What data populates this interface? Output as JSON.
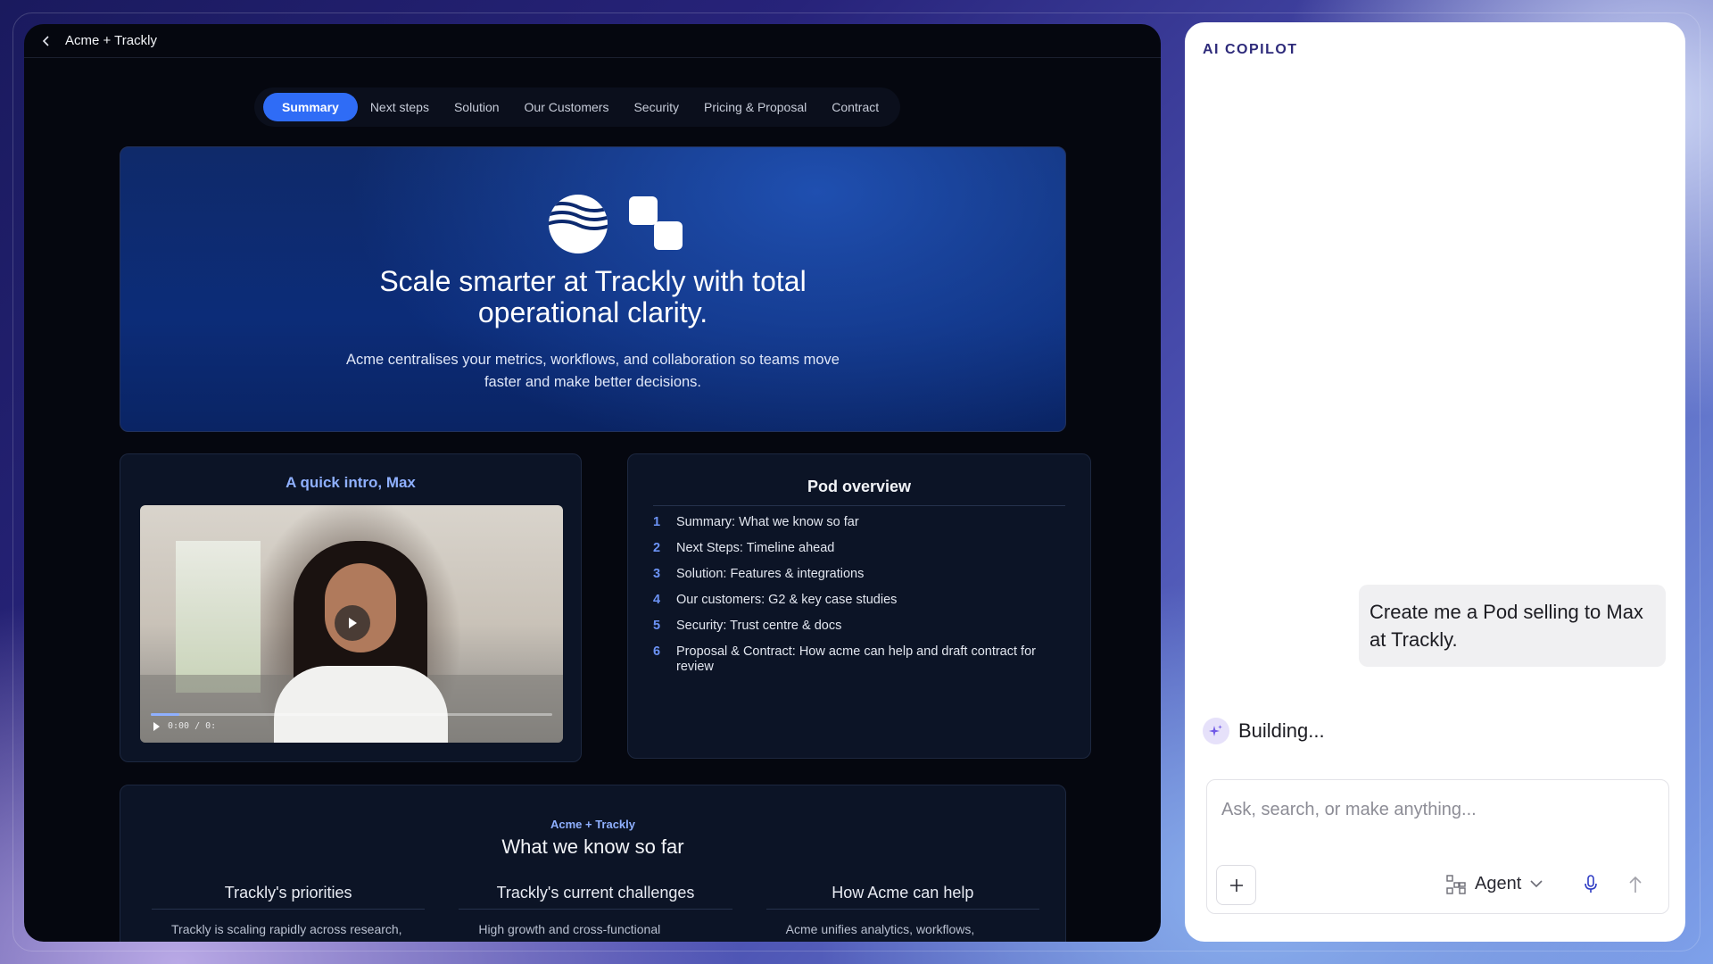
{
  "app": {
    "title": "Acme + Trackly",
    "tabs": [
      {
        "label": "Summary",
        "active": true
      },
      {
        "label": "Next steps"
      },
      {
        "label": "Solution"
      },
      {
        "label": "Our Customers"
      },
      {
        "label": "Security"
      },
      {
        "label": "Pricing & Proposal"
      },
      {
        "label": "Contract"
      }
    ]
  },
  "hero": {
    "title_line1": "Scale smarter at Trackly with total",
    "title_line2": "operational clarity.",
    "subtitle_line1": "Acme centralises your metrics, workflows, and collaboration so teams move",
    "subtitle_line2": "faster and make better decisions."
  },
  "video": {
    "title": "A quick intro, Max",
    "time": "0:00 / 0:",
    "progress": 0.07
  },
  "pod_overview": {
    "title": "Pod overview",
    "items": [
      {
        "num": "1",
        "text": "Summary: What we know so far"
      },
      {
        "num": "2",
        "text": "Next Steps: Timeline ahead"
      },
      {
        "num": "3",
        "text": "Solution: Features & integrations"
      },
      {
        "num": "4",
        "text": "Our customers: G2 & key case studies"
      },
      {
        "num": "5",
        "text": "Security: Trust centre & docs"
      },
      {
        "num": "6",
        "text": "Proposal & Contract: How acme can help and draft contract for review"
      }
    ]
  },
  "know": {
    "eyebrow": "Acme + Trackly",
    "title": "What we know so far",
    "columns": [
      {
        "title": "Trackly's priorities",
        "text": "Trackly is scaling rapidly across research, pro..."
      },
      {
        "title": "Trackly's current challenges",
        "text": "High growth and cross-functional"
      },
      {
        "title": "How Acme can help",
        "text": "Acme unifies analytics, workflows,"
      }
    ]
  },
  "copilot": {
    "title": "AI COPILOT",
    "user_message": "Create me a Pod selling to Max at Trackly.",
    "status": "Building...",
    "input_placeholder": "Ask, search, or make anything...",
    "agent_label": "Agent"
  },
  "colors": {
    "accent": "#2f6cf6",
    "app_bg": "#05070f",
    "copilot_title": "#2d2a7a"
  }
}
